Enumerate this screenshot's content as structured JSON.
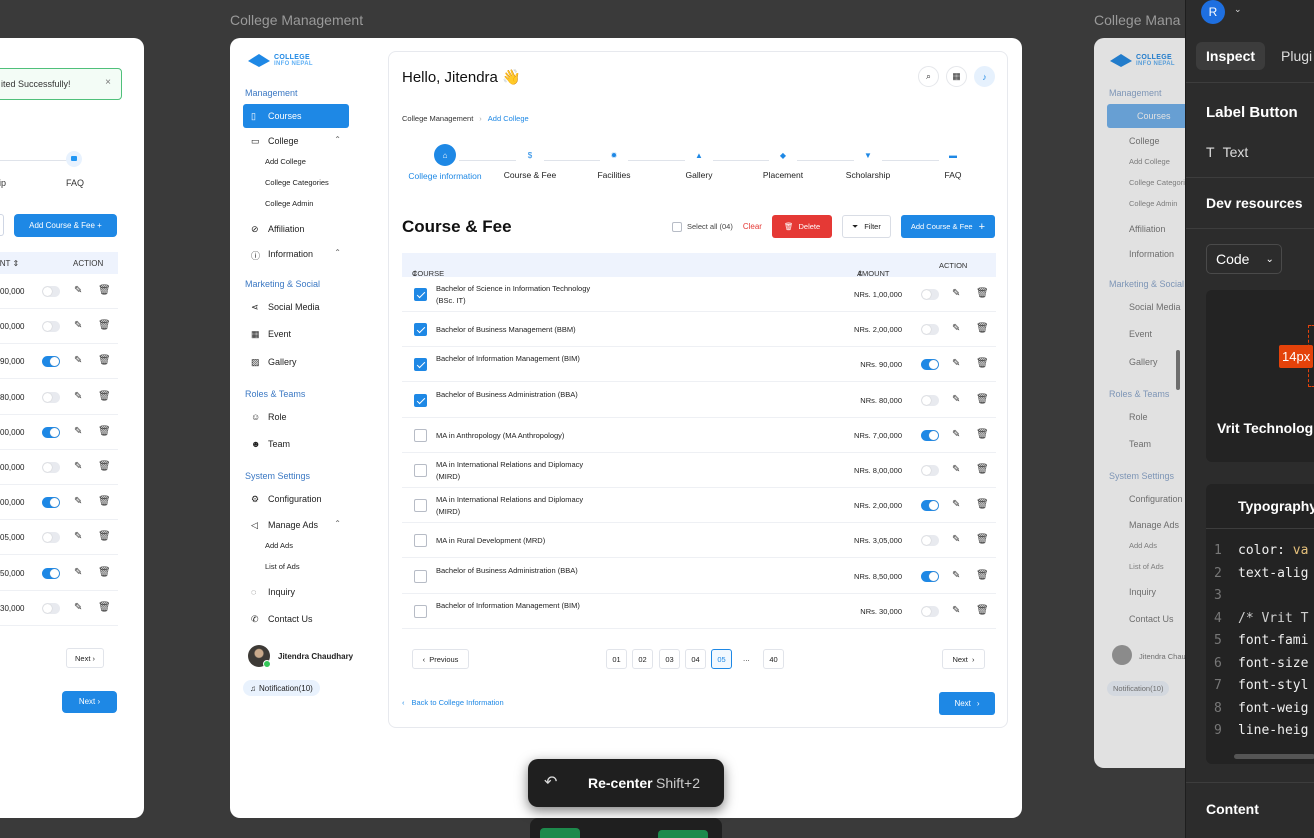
{
  "canvas": {
    "frame_labels": [
      "College Management",
      "College Mana"
    ]
  },
  "left_frame": {
    "toast_text": "ited Successfully!",
    "toast_close": "×",
    "steps": [
      "hip",
      "FAQ"
    ],
    "add_button": "Add Course & Fee  +",
    "headers": [
      "UNT ⇕",
      "ACTION"
    ],
    "amounts": [
      "00,000",
      "00,000",
      "90,000",
      "80,000",
      "00,000",
      "00,000",
      "00,000",
      "05,000",
      "50,000",
      "30,000"
    ],
    "toggles": [
      false,
      false,
      true,
      false,
      true,
      false,
      true,
      false,
      true,
      false
    ],
    "next_label": "Next  ›",
    "next_primary": "Next  ›"
  },
  "app": {
    "logo": {
      "line1": "COLLEGE",
      "line2": "INFO NEPAL"
    },
    "sidebar": {
      "sections": {
        "management": "Management",
        "marketing": "Marketing & Social",
        "roles": "Roles & Teams",
        "system": "System Settings"
      },
      "items": {
        "courses": "Courses",
        "college": "College",
        "add_college": "Add College",
        "college_categories": "College Categories",
        "college_admin": "College Admin",
        "affiliation": "Affiliation",
        "information": "Information",
        "social_media": "Social Media",
        "event": "Event",
        "gallery": "Gallery",
        "role": "Role",
        "team": "Team",
        "configuration": "Configuration",
        "manage_ads": "Manage Ads",
        "add_ads": "Add Ads",
        "list_of_ads": "List of Ads",
        "inquiry": "Inquiry",
        "contact_us": "Contact Us"
      },
      "profile_name": "Jitendra Chaudhary",
      "notification": "Notification(10)"
    },
    "header": {
      "greeting": "Hello, Jitendra 👋"
    },
    "breadcrumb": {
      "root": "College Management",
      "sep": "›",
      "current": "Add College"
    },
    "steps": [
      {
        "label": "College information",
        "icon": "⌂",
        "active": true
      },
      {
        "label": "Course & Fee",
        "icon": "$",
        "active": false
      },
      {
        "label": "Facilities",
        "icon": "✹",
        "active": false
      },
      {
        "label": "Gallery",
        "icon": "▲",
        "active": false
      },
      {
        "label": "Placement",
        "icon": "◆",
        "active": false
      },
      {
        "label": "Scholarship",
        "icon": "▼",
        "active": false
      },
      {
        "label": "FAQ",
        "icon": "▬",
        "active": false
      }
    ],
    "section_title": "Course & Fee",
    "toolbar": {
      "select_all": "Select all (04)",
      "clear": "Clear",
      "delete": "Delete",
      "filter": "Filter",
      "add": "Add Course & Fee"
    },
    "table": {
      "headers": {
        "course": "COURSE",
        "amount": "AMOUNT",
        "action": "ACTION"
      },
      "rows": [
        {
          "course": "Bachelor of Science in Information Technology (BSc. IT)",
          "amount": "NRs. 1,00,000",
          "checked": true,
          "active": false
        },
        {
          "course": "Bachelor of Business Management (BBM)",
          "amount": "NRs. 2,00,000",
          "checked": true,
          "active": false
        },
        {
          "course": "Bachelor of Information Management (BIM)",
          "amount": "NRs. 90,000",
          "checked": true,
          "active": true
        },
        {
          "course": "Bachelor of Business Administration (BBA)",
          "amount": "NRs. 80,000",
          "checked": true,
          "active": false
        },
        {
          "course": "MA in Anthropology (MA Anthropology)",
          "amount": "NRs. 7,00,000",
          "checked": false,
          "active": true
        },
        {
          "course": "MA in International Relations and Diplomacy (MIRD)",
          "amount": "NRs. 8,00,000",
          "checked": false,
          "active": false
        },
        {
          "course": "MA in International Relations and Diplomacy (MIRD)",
          "amount": "NRs. 2,00,000",
          "checked": false,
          "active": true
        },
        {
          "course": "MA in Rural Development (MRD)",
          "amount": "NRs. 3,05,000",
          "checked": false,
          "active": false
        },
        {
          "course": "Bachelor of Business Administration (BBA)",
          "amount": "NRs. 8,50,000",
          "checked": false,
          "active": true
        },
        {
          "course": "Bachelor of Information Management (BIM)",
          "amount": "NRs. 30,000",
          "checked": false,
          "active": false
        }
      ]
    },
    "pagination": {
      "previous": "Previous",
      "pages": [
        "01",
        "02",
        "03",
        "04",
        "05"
      ],
      "current": "05",
      "ellipsis": "...",
      "last": "40",
      "next": "Next"
    },
    "footer": {
      "back": "Back to College Information",
      "next": "Next"
    },
    "colors": {
      "primary": "#1e88e5",
      "danger": "#e53935",
      "success": "#35c759"
    }
  },
  "inspect_panel": {
    "avatar_letter": "R",
    "tabs": [
      "Inspect",
      "Plugi"
    ],
    "heading": "Label Button",
    "text_label": "Text",
    "dev_resources": "Dev resources",
    "code_dropdown": "Code",
    "measure_badge": "14px",
    "preview_text": "Vrit Technologi",
    "typography_title": "Typography",
    "code_lines": [
      {
        "n": "1",
        "k": "color: ",
        "v": "va"
      },
      {
        "n": "2",
        "k": "text-alig",
        "v": ""
      },
      {
        "n": "3",
        "k": "",
        "v": ""
      },
      {
        "n": "4",
        "k": "/* Vrit T",
        "v": ""
      },
      {
        "n": "5",
        "k": "font-fami",
        "v": ""
      },
      {
        "n": "6",
        "k": "font-size",
        "v": ""
      },
      {
        "n": "7",
        "k": "font-styl",
        "v": ""
      },
      {
        "n": "8",
        "k": "font-weig",
        "v": ""
      },
      {
        "n": "9",
        "k": "line-heig",
        "v": ""
      }
    ],
    "content_heading": "Content"
  },
  "recenter": {
    "label": "Re-center",
    "shortcut": "Shift+2",
    "icon": "↶"
  }
}
